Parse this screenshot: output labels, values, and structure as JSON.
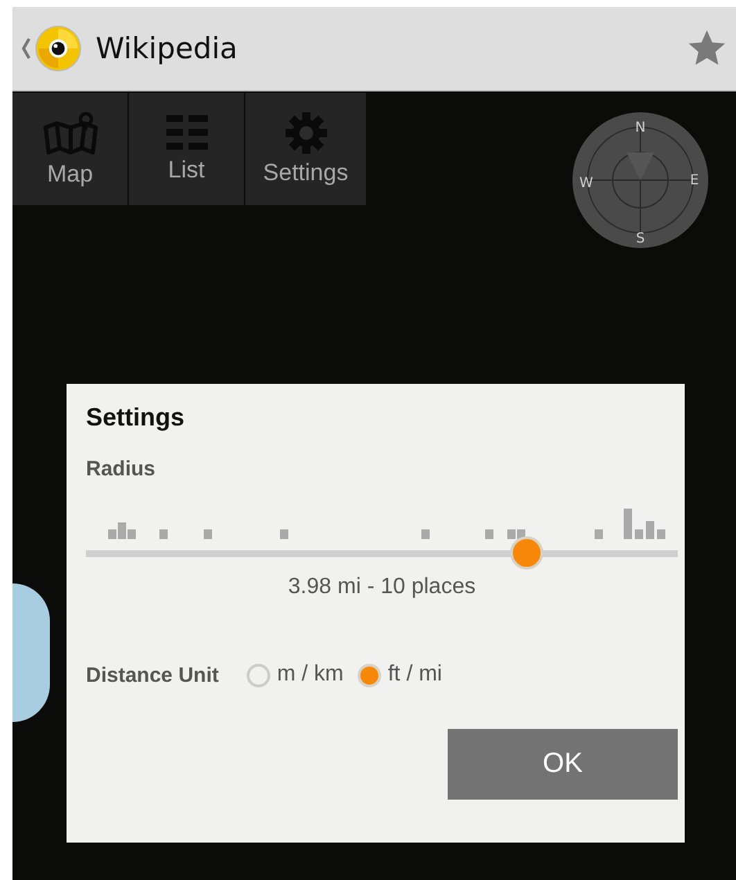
{
  "app_bar": {
    "title": "Wikipedia"
  },
  "toolbar": [
    {
      "label": "Map"
    },
    {
      "label": "List"
    },
    {
      "label": "Settings"
    }
  ],
  "compass": {
    "labels": [
      "N",
      "E",
      "S",
      "W"
    ]
  },
  "dialog": {
    "title": "Settings",
    "radius": {
      "label": "Radius",
      "level": 0.745,
      "reading": "3.98 mi - 10 places"
    },
    "distance_unit": {
      "label": "Distance Unit",
      "options": [
        {
          "label": "m / km",
          "selected": false
        },
        {
          "label": "ft / mi",
          "selected": true
        }
      ]
    },
    "button": "OK"
  }
}
